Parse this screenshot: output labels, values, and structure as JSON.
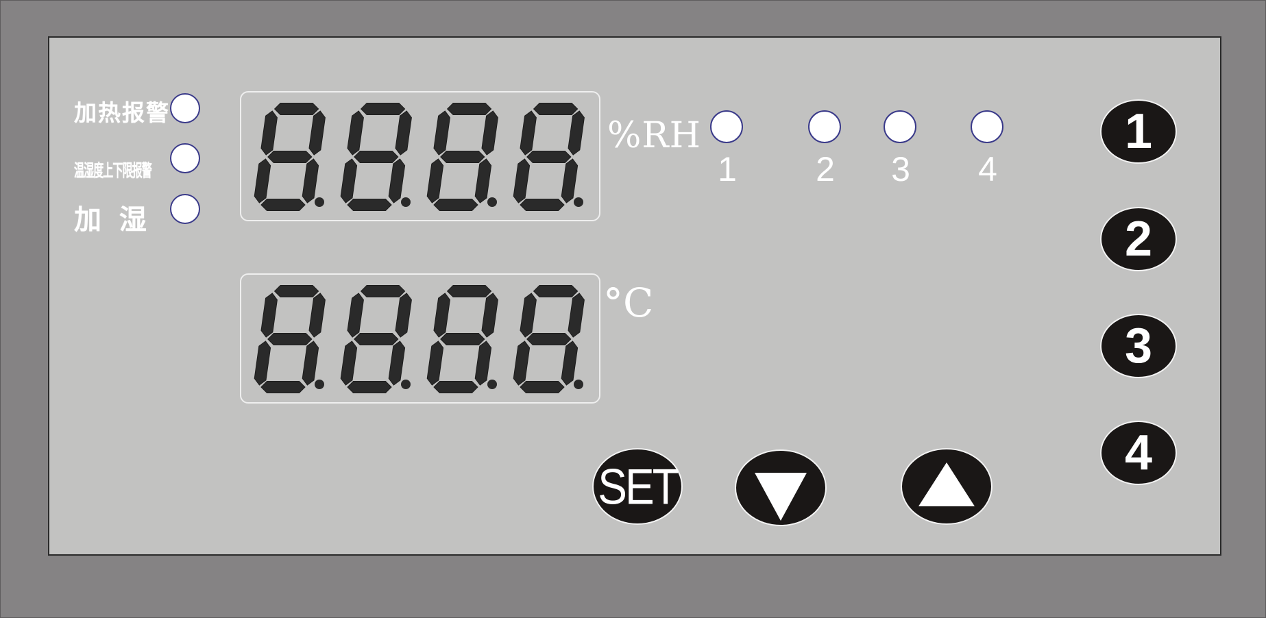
{
  "indicators": {
    "heating_alarm": "加热报警",
    "temp_humidity_limit_alarm": "温湿度上下限报警",
    "humidify": "加 湿"
  },
  "displays": {
    "humidity": {
      "digits": "8.8.8.8.",
      "unit": "%RH"
    },
    "temperature": {
      "digits": "8.8.8.8.",
      "unit": "°C"
    }
  },
  "channel_labels": [
    "1",
    "2",
    "3",
    "4"
  ],
  "channel_keys": [
    "1",
    "2",
    "3",
    "4"
  ],
  "controls": {
    "set_label": "SET",
    "down_icon": "triangle-down-icon",
    "up_icon": "triangle-up-icon"
  },
  "colors": {
    "panel": "#c2c2c1",
    "frame": "#858384",
    "segment": "#2a2a2a",
    "key": "#1a1716",
    "led": "#ffffff"
  }
}
